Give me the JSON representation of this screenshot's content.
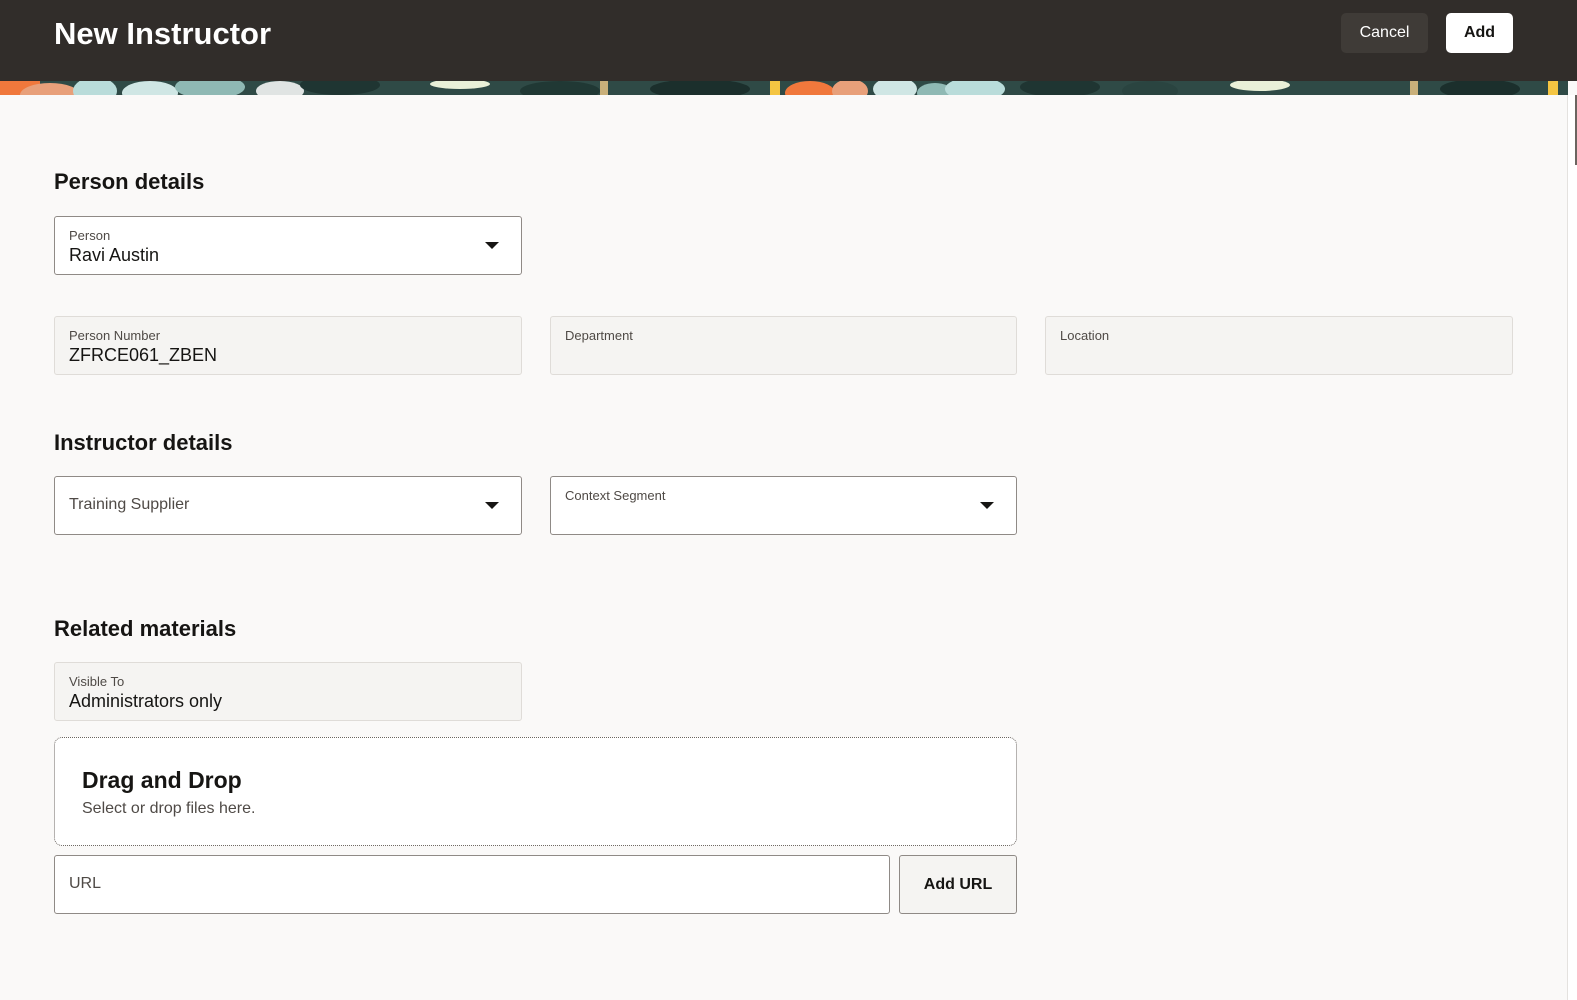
{
  "header": {
    "title": "New Instructor",
    "cancel_label": "Cancel",
    "add_label": "Add"
  },
  "person_details": {
    "title": "Person details",
    "person": {
      "label": "Person",
      "value": "Ravi Austin"
    },
    "person_number": {
      "label": "Person Number",
      "value": "ZFRCE061_ZBEN"
    },
    "department": {
      "label": "Department",
      "value": ""
    },
    "location": {
      "label": "Location",
      "value": ""
    }
  },
  "instructor_details": {
    "title": "Instructor details",
    "training_supplier": {
      "placeholder": "Training Supplier"
    },
    "context_segment": {
      "label": "Context Segment",
      "value": ""
    }
  },
  "related_materials": {
    "title": "Related materials",
    "visible_to": {
      "label": "Visible To",
      "value": "Administrators only"
    },
    "dropzone": {
      "title": "Drag and Drop",
      "subtitle": "Select or drop files here."
    },
    "url": {
      "placeholder": "URL"
    },
    "add_url_label": "Add URL"
  },
  "colors": {
    "header_bg": "#312d2a",
    "page_bg": "#faf9f8",
    "banner_teal": "#2f4a46",
    "banner_orange": "#f0783c"
  }
}
